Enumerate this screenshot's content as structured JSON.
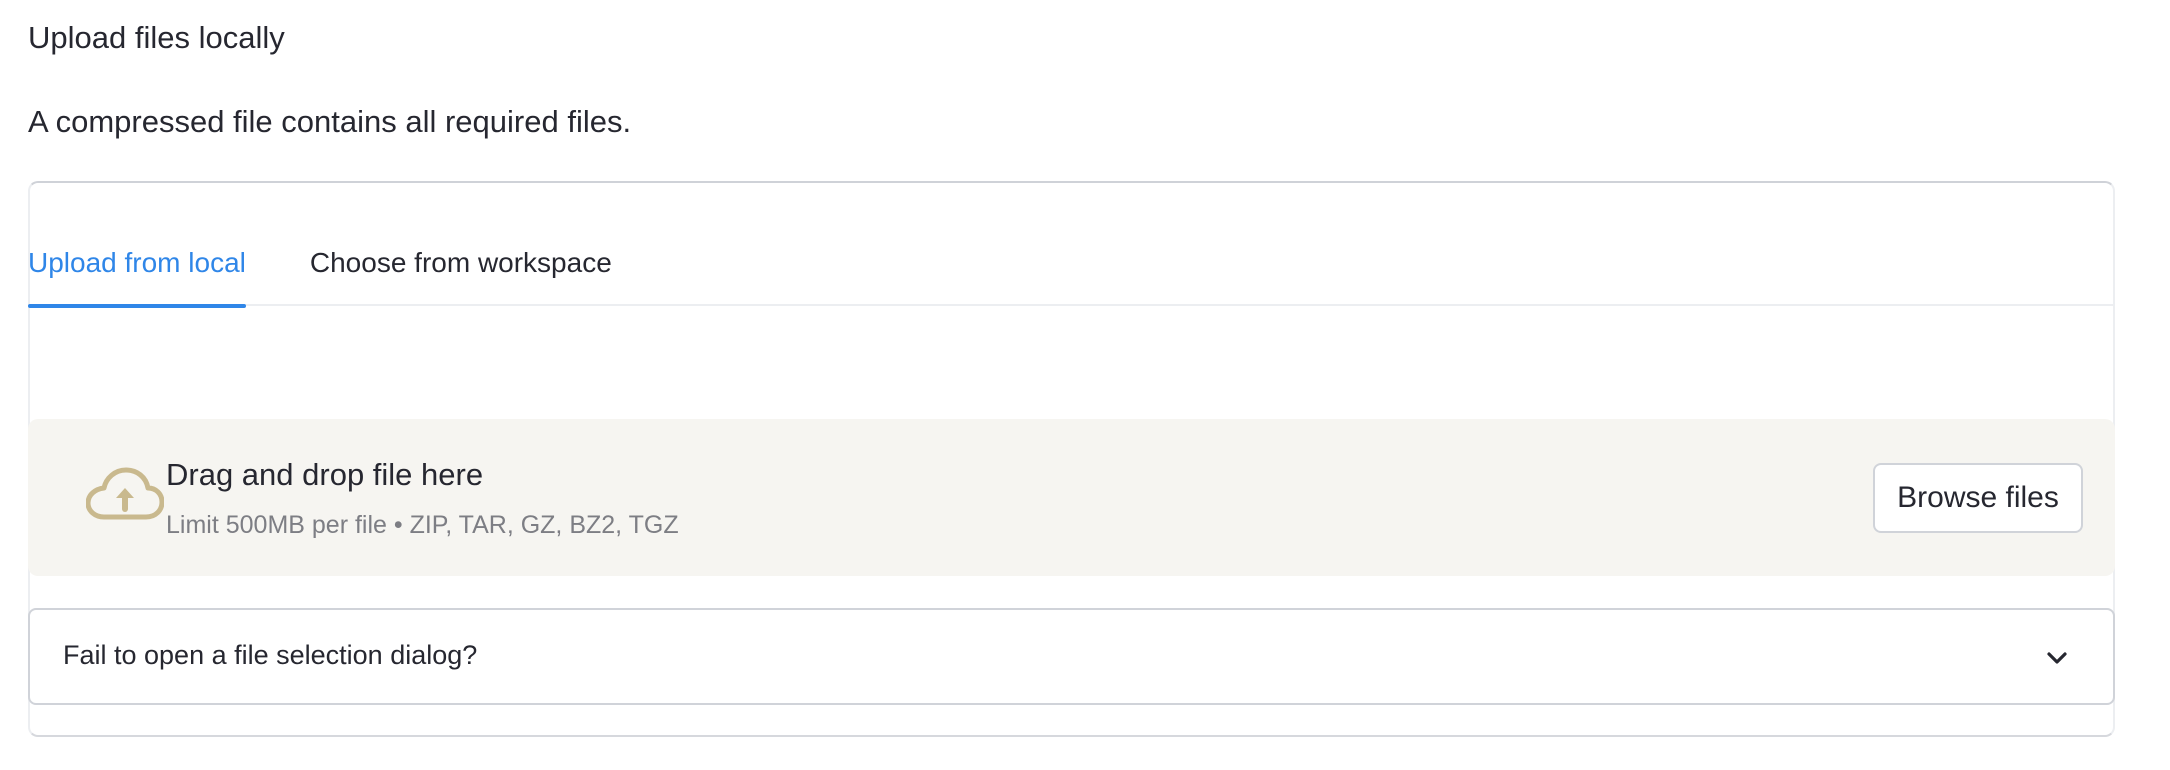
{
  "section": {
    "title": "Upload files locally",
    "description": "A compressed file contains all required files."
  },
  "tabs": [
    {
      "label": "Upload from local",
      "active": true
    },
    {
      "label": "Choose from workspace",
      "active": false
    }
  ],
  "dropzone": {
    "icon": "cloud-upload-icon",
    "title": "Drag and drop file here",
    "subtitle": "Limit 500MB per file • ZIP, TAR, GZ, BZ2, TGZ",
    "browse_label": "Browse files"
  },
  "expander": {
    "label": "Fail to open a file selection dialog?",
    "icon": "chevron-down-icon"
  },
  "colors": {
    "accent": "#2f86e8",
    "dropzone_bg": "#f6f5f1",
    "cloud_icon": "#c9b98e"
  }
}
